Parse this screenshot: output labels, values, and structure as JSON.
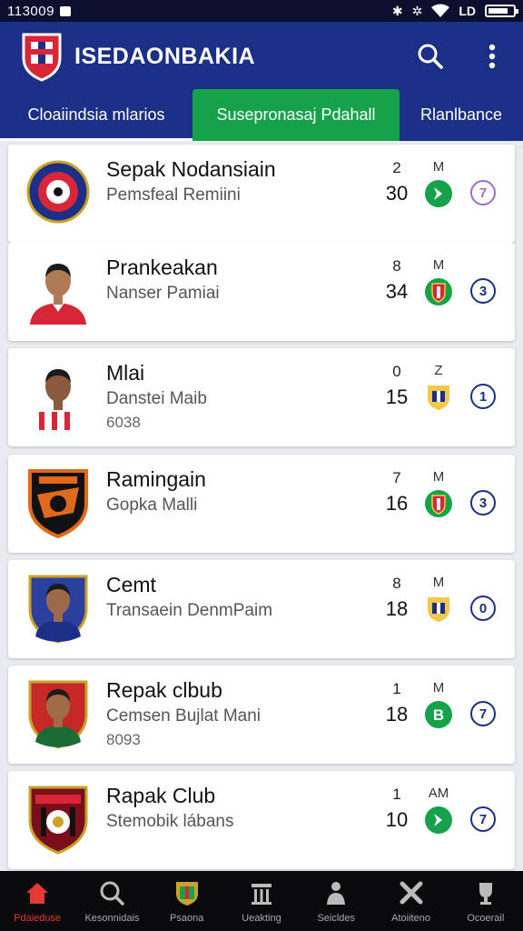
{
  "status": {
    "time": "113009"
  },
  "app": {
    "title": "ISEDAONBAKIA"
  },
  "tabs": [
    "Cloaiindsia mlarios",
    "Susepronasaj Pdahall",
    "Rlanlbance"
  ],
  "players": [
    {
      "name": "Sepak Nodansiain",
      "sub": "Pemsfeal Remiini",
      "sub2": "",
      "stat_top": "2",
      "stat": "30",
      "col_top": "M",
      "badge": "arrow",
      "rank": "7",
      "rank_style": "purple",
      "avatar": "club-ball"
    },
    {
      "name": "Prankeakan",
      "sub": "Nanser Pamiai",
      "sub2": "",
      "stat_top": "8",
      "stat": "34",
      "col_top": "M",
      "badge": "shield-red",
      "rank": "3",
      "rank_style": "navy",
      "avatar": "player-red"
    },
    {
      "name": "Mlai",
      "sub": "Danstei Maib",
      "sub2": "6038",
      "stat_top": "0",
      "stat": "15",
      "col_top": "Z",
      "badge": "shield-yellow",
      "rank": "1",
      "rank_style": "navy",
      "avatar": "player-stripe"
    },
    {
      "name": "Ramingain",
      "sub": "Gopka Malli",
      "sub2": "",
      "stat_top": "7",
      "stat": "16",
      "col_top": "M",
      "badge": "shield-red",
      "rank": "3",
      "rank_style": "navy",
      "avatar": "club-orange"
    },
    {
      "name": "Cemt",
      "sub": "Transaein DenmPaim",
      "sub2": "",
      "stat_top": "8",
      "stat": "18",
      "col_top": "M",
      "badge": "shield-yellow",
      "rank": "0",
      "rank_style": "navy",
      "avatar": "player-blue"
    },
    {
      "name": "Repak clbub",
      "sub": "Cemsen Bujlat Mani",
      "sub2": "8093",
      "stat_top": "1",
      "stat": "18",
      "col_top": "M",
      "badge": "letter-b",
      "rank": "7",
      "rank_style": "navy",
      "avatar": "player-green"
    },
    {
      "name": "Rapak Club",
      "sub": "Stemobik lábans",
      "sub2": "",
      "stat_top": "1",
      "stat": "10",
      "col_top": "AM",
      "badge": "arrow",
      "rank": "7",
      "rank_style": "navy",
      "avatar": "club-red"
    }
  ],
  "nav": [
    {
      "label": "Pdaieduse",
      "icon": "home-icon",
      "active": true
    },
    {
      "label": "Kesonnidais",
      "icon": "search-icon",
      "active": false
    },
    {
      "label": "Psaona",
      "icon": "club-icon",
      "active": false
    },
    {
      "label": "Ueakting",
      "icon": "stadium-icon",
      "active": false
    },
    {
      "label": "Seicldes",
      "icon": "person-icon",
      "active": false
    },
    {
      "label": "Atoiiteno",
      "icon": "close-icon",
      "active": false
    },
    {
      "label": "Ocoerail",
      "icon": "trophy-icon",
      "active": false
    }
  ],
  "colors": {
    "primary": "#1c2f86",
    "accent": "#15a24a",
    "statusbar": "#0c0f2e",
    "nav_active": "#e53935"
  }
}
